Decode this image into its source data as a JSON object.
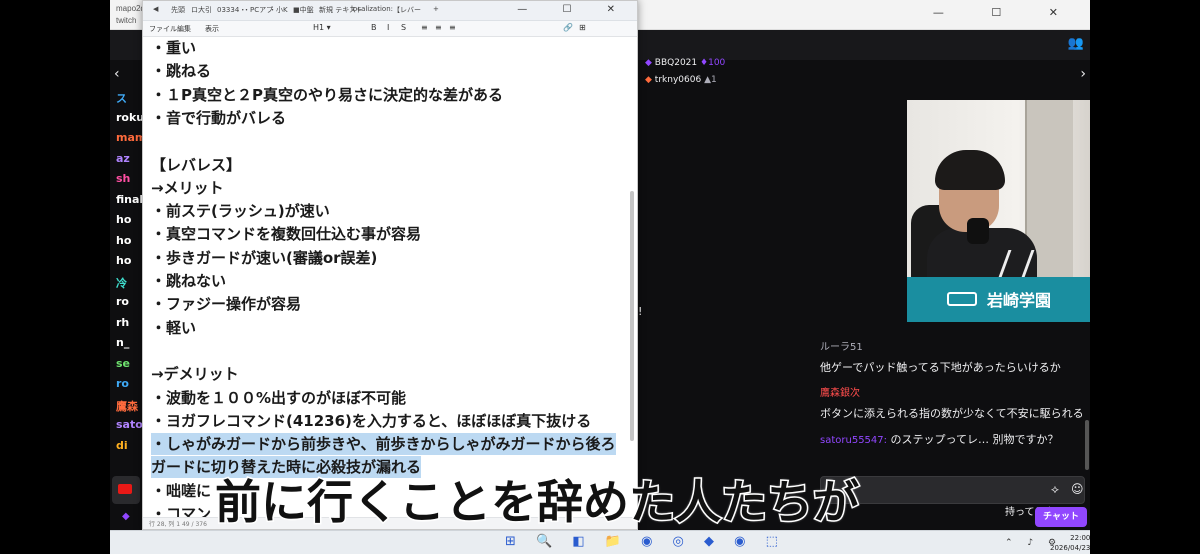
{
  "browser": {
    "tab_title": "mapo2d",
    "tab_title2": "twitch",
    "window_controls": "— ☐ ✕"
  },
  "editor": {
    "tabs": [
      "◀",
      "先頭",
      "ロ大引",
      "03334・",
      "・PCアプ",
      "・小K",
      "■中盤",
      "新規 テキスト",
      "localization:",
      "【レバー",
      "+"
    ],
    "window_controls": "— ☐ ✕",
    "menu": [
      "ファイル",
      "編集",
      "表示"
    ],
    "toolbar": [
      "H1 ▾",
      "B",
      "I",
      "S",
      "≡",
      "≡",
      "≡",
      "🔗",
      "⊞"
    ],
    "lines": [
      "・重い",
      "・跳ねる",
      "・１P真空と２P真空のやり易さに決定的な差がある",
      "・音で行動がバレる",
      "",
      "【レバレス】",
      "→メリット",
      "・前ステ(ラッシュ)が速い",
      "・真空コマンドを複数回仕込む事が容易",
      "・歩きガードが速い(審議or誤差)",
      "・跳ねない",
      "・ファジー操作が容易",
      "・軽い",
      "",
      "→デメリット",
      "・波動を１００%出すのがほぼ不可能",
      "・ヨガフレコマンド(41236)を入力すると、ほぼほぼ真下抜ける",
      "・しゃがみガードから前歩きや、前歩きからしゃがみガードから後ろ",
      "ガードに切り替えた時に必殺技が漏れる",
      "・咄嗟に",
      "・コマン"
    ],
    "status": "行 28, 列 1    49 / 376"
  },
  "twitch": {
    "supporters": [
      {
        "name": "BBQ2021",
        "badge": "◆",
        "count": "100"
      },
      {
        "name": "trkny0606",
        "badge": "◆",
        "count": "1"
      }
    ],
    "sidebar": [
      {
        "label": "ス",
        "color": "#3fa9f5"
      },
      {
        "label": "roku",
        "color": "#ffffff"
      },
      {
        "label": "mam",
        "color": "#ff6b3d"
      },
      {
        "label": "az",
        "color": "#b084ff"
      },
      {
        "label": "sh",
        "color": "#ff4fa3"
      },
      {
        "label": "final",
        "color": "#ffffff"
      },
      {
        "label": "ho",
        "color": "#ffffff"
      },
      {
        "label": "ho",
        "color": "#ffffff"
      },
      {
        "label": "ho",
        "color": "#ffffff"
      },
      {
        "label": "冷",
        "color": "#3fe0d0"
      },
      {
        "label": "ro",
        "color": "#ffffff"
      },
      {
        "label": "rh",
        "color": "#ffffff"
      },
      {
        "label": "n_",
        "color": "#ffffff"
      },
      {
        "label": "se",
        "color": "#6fe36f"
      },
      {
        "label": "ro",
        "color": "#3fa9f5"
      },
      {
        "label": "鷹森",
        "color": "#ff6b3d"
      },
      {
        "label": "sato",
        "color": "#b084ff"
      },
      {
        "label": "di",
        "color": "#ffb020"
      }
    ],
    "chat": [
      {
        "user": "ルーラ51",
        "user_color": "#adadb8",
        "text": "他ゲーでパッド触ってる下地があったらいけるか"
      },
      {
        "user": "鷹森銀次",
        "user_color": "#ff4d4d",
        "text": "ボタンに添えられる指の数が少なくて不安に駆られる"
      },
      {
        "user": "satoru55547:",
        "user_color": "#9147ff",
        "text": "のステップってレ… 別物ですか？"
      }
    ],
    "chat_partial": "持ってるよ",
    "chat_button": "チャット",
    "cam_banner": "岩崎学園",
    "exclaim": "!"
  },
  "subtitle": "前に行くことを辞めた人たちが",
  "taskbar": {
    "clock_time": "22:00",
    "clock_date": "2026/04/23"
  }
}
